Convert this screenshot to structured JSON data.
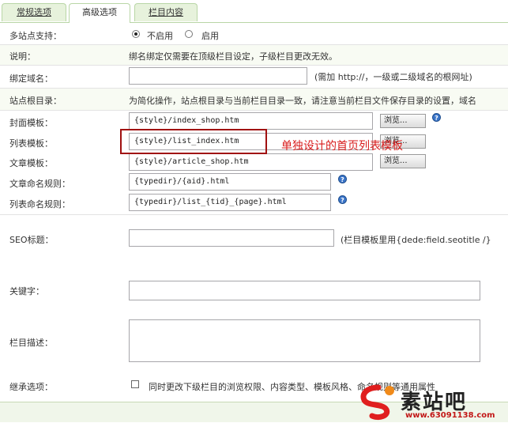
{
  "tabs": [
    "常规选项",
    "高级选项",
    "栏目内容"
  ],
  "multisite": {
    "label": "多站点支持：",
    "options": [
      "不启用",
      "启用"
    ],
    "selected": "不启用"
  },
  "note": {
    "label": "说明：",
    "text": "绑名绑定仅需要在顶级栏目设定，子级栏目更改无效。"
  },
  "domain": {
    "label": "绑定域名：",
    "value": "",
    "hint": "(需加 http://，一级或二级域名的根网址)"
  },
  "root_dir": {
    "label": "站点根目录：",
    "text": "为简化操作，站点根目录与当前栏目目录一致，请注意当前栏目文件保存目录的设置，域名"
  },
  "cover_tpl": {
    "label": "封面模板：",
    "value": "{style}/index_shop.htm",
    "button": "浏览..."
  },
  "list_tpl": {
    "label": "列表模板：",
    "value": "{style}/list_index.htm",
    "button": "浏览..."
  },
  "article_tpl": {
    "label": "文章模板：",
    "value": "{style}/article_shop.htm",
    "button": "浏览..."
  },
  "article_rule": {
    "label": "文章命名规则：",
    "value": "{typedir}/{aid}.html"
  },
  "list_rule": {
    "label": "列表命名规则：",
    "value": "{typedir}/list_{tid}_{page}.html"
  },
  "seo_title": {
    "label": "SEO标题：",
    "value": "",
    "hint": "(栏目模板里用{dede:field.seotitle /}"
  },
  "keywords": {
    "label": "关键字：",
    "value": ""
  },
  "description": {
    "label": "栏目描述：",
    "value": ""
  },
  "inherit": {
    "label": "继承选项：",
    "text": "同时更改下级栏目的浏览权限、内容类型、模板风格、命名规则等通用属性"
  },
  "annotation": {
    "text": "单独设计的首页列表模板"
  },
  "logo": {
    "text": "素站吧",
    "url": "www.63091138.com"
  },
  "colors": {
    "tab_bg": "#e7f2dc",
    "border": "#b9d6a6",
    "annotation": "#d81b1b",
    "help_icon": "#3a74c8"
  }
}
